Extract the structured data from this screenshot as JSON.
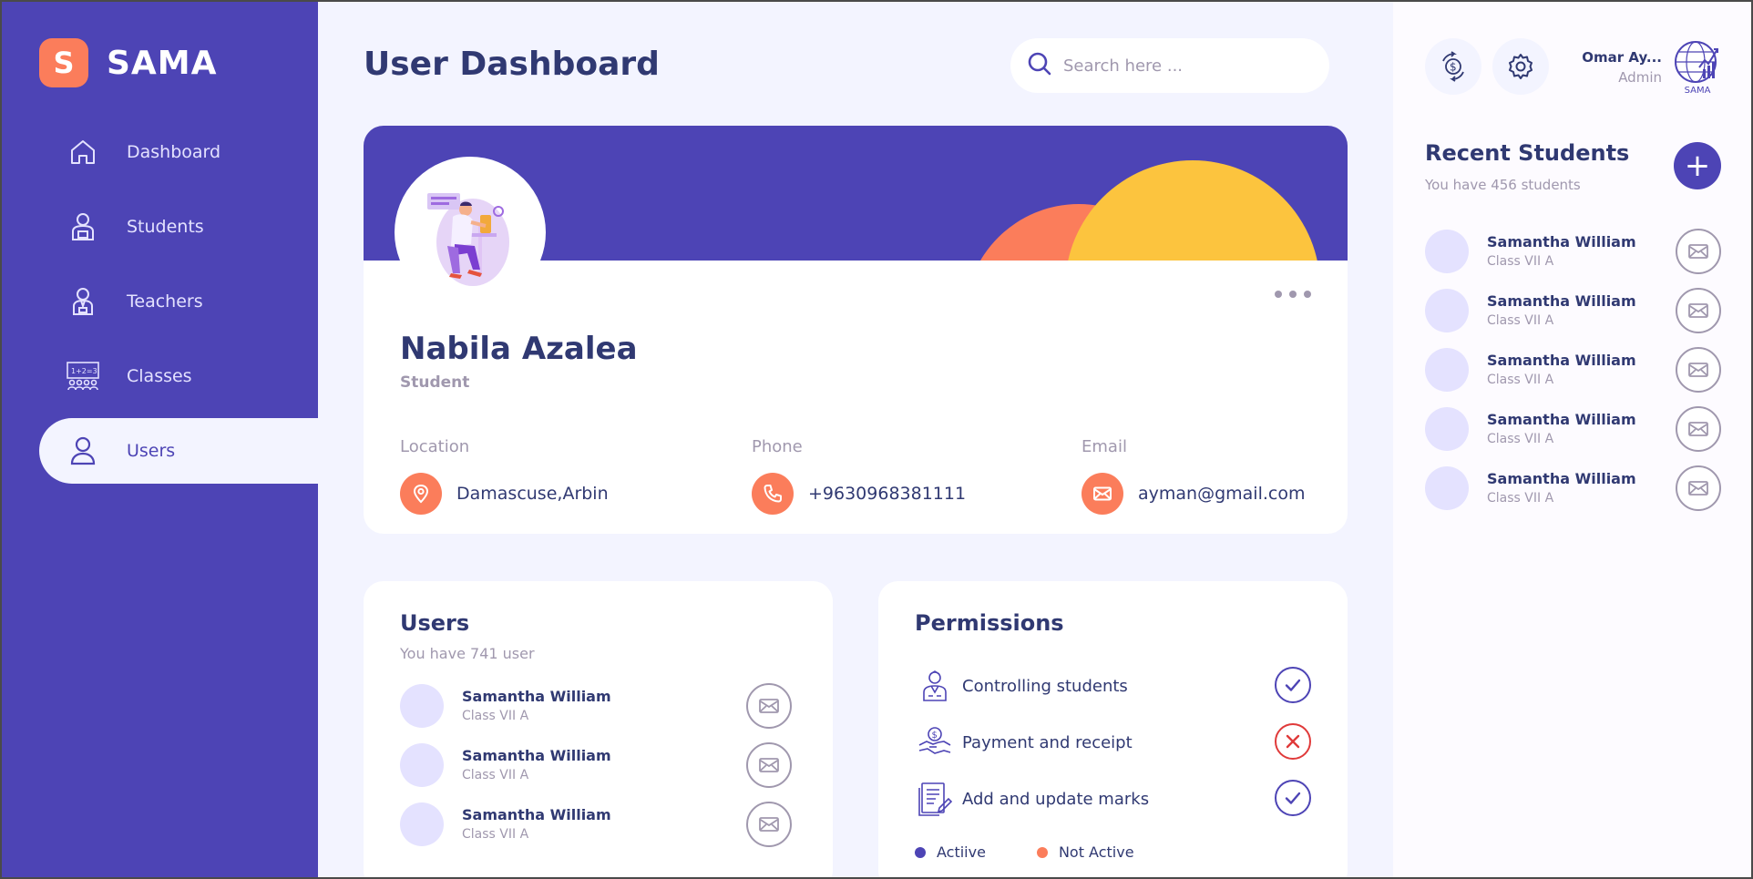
{
  "brand": {
    "initial": "S",
    "name": "SAMA"
  },
  "nav": [
    {
      "label": "Dashboard",
      "icon": "home-icon"
    },
    {
      "label": "Students",
      "icon": "student-icon"
    },
    {
      "label": "Teachers",
      "icon": "teacher-icon"
    },
    {
      "label": "Classes",
      "icon": "classroom-icon"
    },
    {
      "label": "Users",
      "icon": "user-icon",
      "active": true
    }
  ],
  "header": {
    "title": "User Dashboard",
    "search_placeholder": "Search here ..."
  },
  "profile": {
    "name": "Nabila Azalea",
    "role": "Student",
    "location_label": "Location",
    "location_value": "Damascuse,Arbin",
    "phone_label": "Phone",
    "phone_value": "+9630968381111",
    "email_label": "Email",
    "email_value": "ayman@gmail.com"
  },
  "users": {
    "title": "Users",
    "subtitle": "You have 741 user",
    "items": [
      {
        "name": "Samantha William",
        "class": "Class VII A"
      },
      {
        "name": "Samantha William",
        "class": "Class VII A"
      },
      {
        "name": "Samantha William",
        "class": "Class VII A"
      }
    ]
  },
  "permissions": {
    "title": "Permissions",
    "items": [
      {
        "label": "Controlling students",
        "active": true
      },
      {
        "label": "Payment and receipt",
        "active": false
      },
      {
        "label": "Add and update marks",
        "active": true
      }
    ],
    "legend_active": "Actiive",
    "legend_inactive": "Not Active"
  },
  "account": {
    "name": "Omar Ay...",
    "role": "Admin",
    "avatar_logo_text": "SAMA"
  },
  "recent": {
    "title": "Recent Students",
    "subtitle": "You have 456 students",
    "add_label": "+",
    "items": [
      {
        "name": "Samantha William",
        "class": "Class VII A"
      },
      {
        "name": "Samantha William",
        "class": "Class VII A"
      },
      {
        "name": "Samantha William",
        "class": "Class VII A"
      },
      {
        "name": "Samantha William",
        "class": "Class VII A"
      },
      {
        "name": "Samantha William",
        "class": "Class VII A"
      }
    ]
  },
  "colors": {
    "primary": "#4D44B5",
    "accent_orange": "#FB7D5B",
    "accent_yellow": "#FCC43E",
    "background": "#F3F4FF",
    "text_dark": "#303972",
    "text_muted": "#A098AE",
    "inactive_red": "#E03A3A"
  }
}
